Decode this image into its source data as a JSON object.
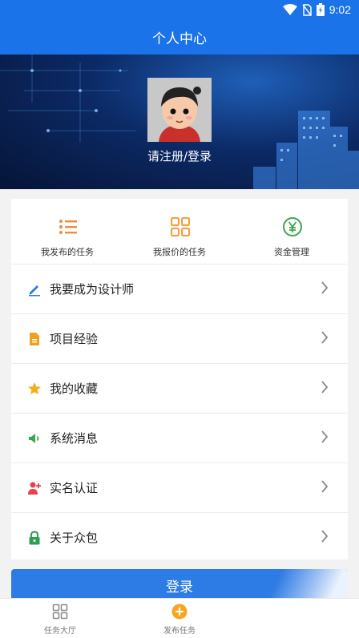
{
  "status_bar": {
    "time": "9:02",
    "icons": [
      "wifi-icon",
      "no-sim-icon",
      "battery-icon"
    ]
  },
  "app_bar": {
    "title": "个人中心"
  },
  "profile": {
    "login_link": "请注册/登录",
    "avatar": "avatar-image"
  },
  "quick_actions": [
    {
      "label": "我发布的任务",
      "icon": "list-icon",
      "color": "#f08a3c"
    },
    {
      "label": "我报价的任务",
      "icon": "grid-icon",
      "color": "#f0a24a"
    },
    {
      "label": "资金管理",
      "icon": "yen-icon",
      "color": "#3aa64a"
    }
  ],
  "menu": [
    {
      "label": "我要成为设计师",
      "icon": "pen-icon",
      "color": "#2d7be5"
    },
    {
      "label": "项目经验",
      "icon": "document-icon",
      "color": "#f0a020"
    },
    {
      "label": "我的收藏",
      "icon": "star-icon",
      "color": "#f2b01e"
    },
    {
      "label": "系统消息",
      "icon": "speaker-icon",
      "color": "#3aa64a"
    },
    {
      "label": "实名认证",
      "icon": "add-user-icon",
      "color": "#e8404a"
    },
    {
      "label": "关于众包",
      "icon": "lock-icon",
      "color": "#2aa050"
    }
  ],
  "login_button": {
    "label": "登录"
  },
  "bottom_nav": [
    {
      "label": "任务大厅",
      "icon": "grid-icon"
    },
    {
      "label": "发布任务",
      "icon": "plus-circle-icon",
      "color": "#f5a623"
    }
  ],
  "colors": {
    "primary": "#1a73e8",
    "button": "#2d7be5"
  }
}
